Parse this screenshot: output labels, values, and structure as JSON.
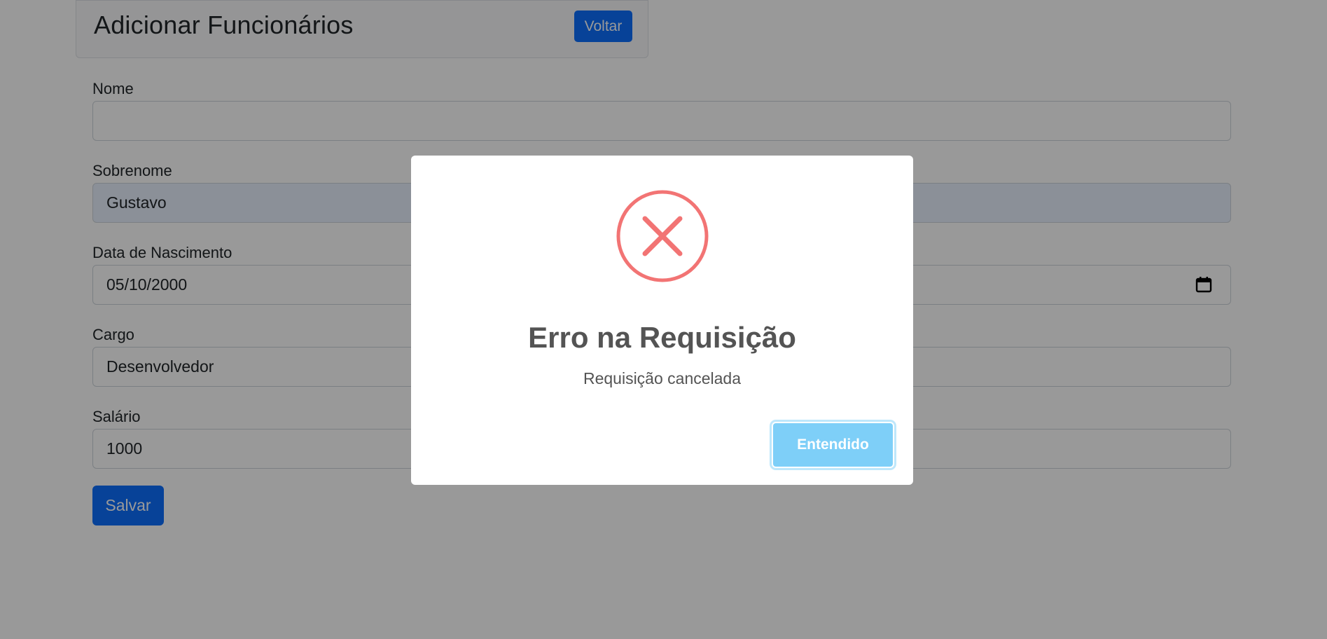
{
  "header": {
    "title": "Adicionar Funcionários",
    "back_label": "Voltar"
  },
  "form": {
    "fields": [
      {
        "label": "Nome",
        "value": ""
      },
      {
        "label": "Sobrenome",
        "value": "Gustavo"
      },
      {
        "label": "Data de Nascimento",
        "value": "05/10/2000"
      },
      {
        "label": "Cargo",
        "value": "Desenvolvedor"
      },
      {
        "label": "Salário",
        "value": "1000"
      }
    ],
    "submit_label": "Salvar"
  },
  "modal": {
    "icon": "error-x-icon",
    "title": "Erro na Requisição",
    "text": "Requisição cancelada",
    "confirm_label": "Entendido"
  },
  "colors": {
    "primary": "#0d6efd",
    "error": "#f27474",
    "confirm": "#7ecff8"
  }
}
